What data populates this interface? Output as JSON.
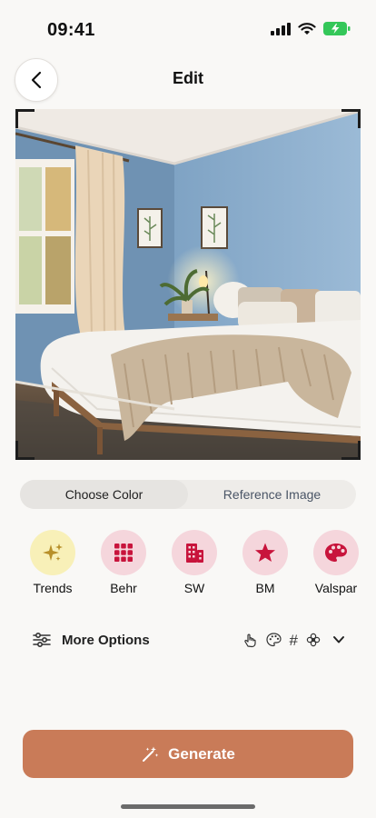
{
  "status_bar": {
    "time": "09:41"
  },
  "nav": {
    "title": "Edit"
  },
  "tabs": [
    {
      "label": "Choose Color",
      "active": true
    },
    {
      "label": "Reference Image",
      "active": false
    }
  ],
  "color_sources": [
    {
      "label": "Trends",
      "icon": "sparkle-icon"
    },
    {
      "label": "Behr",
      "icon": "grid-icon"
    },
    {
      "label": "SW",
      "icon": "building-icon"
    },
    {
      "label": "BM",
      "icon": "star-icon"
    },
    {
      "label": "Valspar",
      "icon": "palette-icon"
    }
  ],
  "more_options": {
    "label": "More Options",
    "mode_icons": [
      "pointer-icon",
      "palette-icon",
      "hash-icon",
      "flower-icon",
      "chevron-down-icon"
    ],
    "hash_glyph": "#"
  },
  "generate": {
    "label": "Generate"
  },
  "colors": {
    "accent": "#c97b58",
    "chip_bg": "#f5d6dc",
    "chip_icon": "#c8143c",
    "trend_bg": "#f8f0b8"
  }
}
